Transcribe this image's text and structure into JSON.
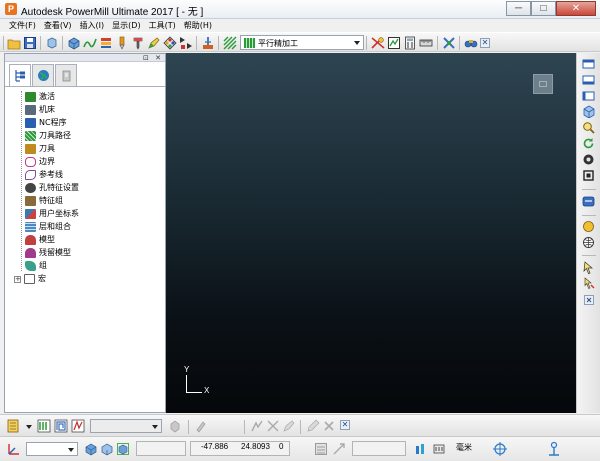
{
  "window": {
    "app_icon_glyph": "P",
    "title": "Autodesk PowerMill Ultimate 2017   [ - 无 ]",
    "minimize_glyph": "─",
    "maximize_glyph": "□",
    "close_glyph": "✕"
  },
  "menu": {
    "items": [
      {
        "label": "文件(F)"
      },
      {
        "label": "查看(V)"
      },
      {
        "label": "插入(I)"
      },
      {
        "label": "显示(D)"
      },
      {
        "label": "工具(T)"
      },
      {
        "label": "帮助(H)"
      }
    ]
  },
  "toolbar": {
    "strategy_value": "平行精加工",
    "close_glyph": "✕"
  },
  "explorer": {
    "panel_buttons": "⊡ ✕",
    "tree": [
      {
        "label": "激活",
        "icon": "activate-icon",
        "color": "#2f8a2f"
      },
      {
        "label": "机床",
        "icon": "machine-icon",
        "color": "#5a6a7a"
      },
      {
        "label": "NC程序",
        "icon": "nc-program-icon",
        "color": "#2a5fb0"
      },
      {
        "label": "刀具路径",
        "icon": "toolpath-icon",
        "color": "#2a9a3a"
      },
      {
        "label": "刀具",
        "icon": "tool-icon",
        "color": "#c08a20"
      },
      {
        "label": "边界",
        "icon": "boundary-icon",
        "color": "#c03a8a"
      },
      {
        "label": "参考线",
        "icon": "pattern-icon",
        "color": "#7a4aa0"
      },
      {
        "label": "孔特征设置",
        "icon": "feature-set-icon",
        "color": "#444444"
      },
      {
        "label": "特征组",
        "icon": "feature-group-icon",
        "color": "#8a6a3a"
      },
      {
        "label": "用户坐标系",
        "icon": "workplane-icon",
        "color": "#3a7ab0"
      },
      {
        "label": "层和组合",
        "icon": "levels-icon",
        "color": "#4a8ac0"
      },
      {
        "label": "模型",
        "icon": "model-icon",
        "color": "#c04040"
      },
      {
        "label": "残留模型",
        "icon": "stock-model-icon",
        "color": "#a03a8a"
      },
      {
        "label": "组",
        "icon": "group-icon",
        "color": "#3aa08a"
      },
      {
        "label": "宏",
        "icon": "macro-icon",
        "color": "#606060"
      }
    ]
  },
  "viewport": {
    "axis_x": "X",
    "axis_y": "Y",
    "background_top": "#2e4552",
    "background_bottom": "#05080b"
  },
  "bottom_toolbar": {
    "close_glyph": "✕"
  },
  "statusbar": {
    "coord_x": "-47.886",
    "coord_y": "24.8093",
    "coord_z": "0",
    "units": "毫米"
  }
}
